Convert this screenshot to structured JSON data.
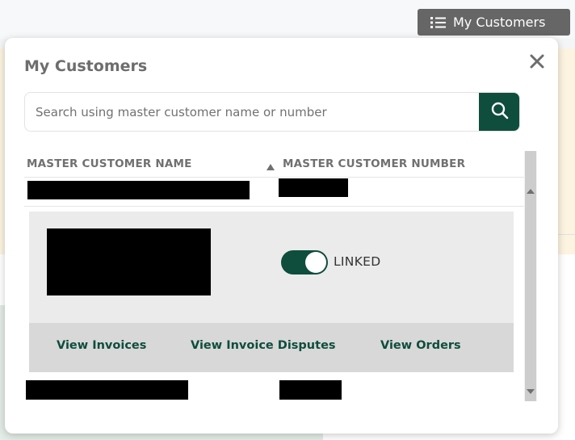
{
  "topbar": {
    "my_customers_button": "My Customers"
  },
  "modal": {
    "title": "My Customers",
    "search": {
      "placeholder": "Search using master customer name or number",
      "value": ""
    },
    "columns": [
      {
        "label": "MASTER CUSTOMER NAME"
      },
      {
        "label": "MASTER CUSTOMER NUMBER"
      }
    ],
    "sort_column": "MASTER CUSTOMER NAME",
    "sort_direction": "ascending",
    "expanded_row": {
      "link_toggle_on": true,
      "status_label": "LINKED",
      "actions": [
        {
          "label": "View Invoices"
        },
        {
          "label": "View Invoice Disputes"
        },
        {
          "label": "View Orders"
        }
      ]
    },
    "icons": {
      "top_button": "list-icon",
      "close": "close-icon",
      "search": "search-icon",
      "sort": "sort-up-icon"
    }
  },
  "colors": {
    "brand_green": "#0f4d3c",
    "dark_button": "#666666",
    "banner": "#fdf3e1"
  }
}
